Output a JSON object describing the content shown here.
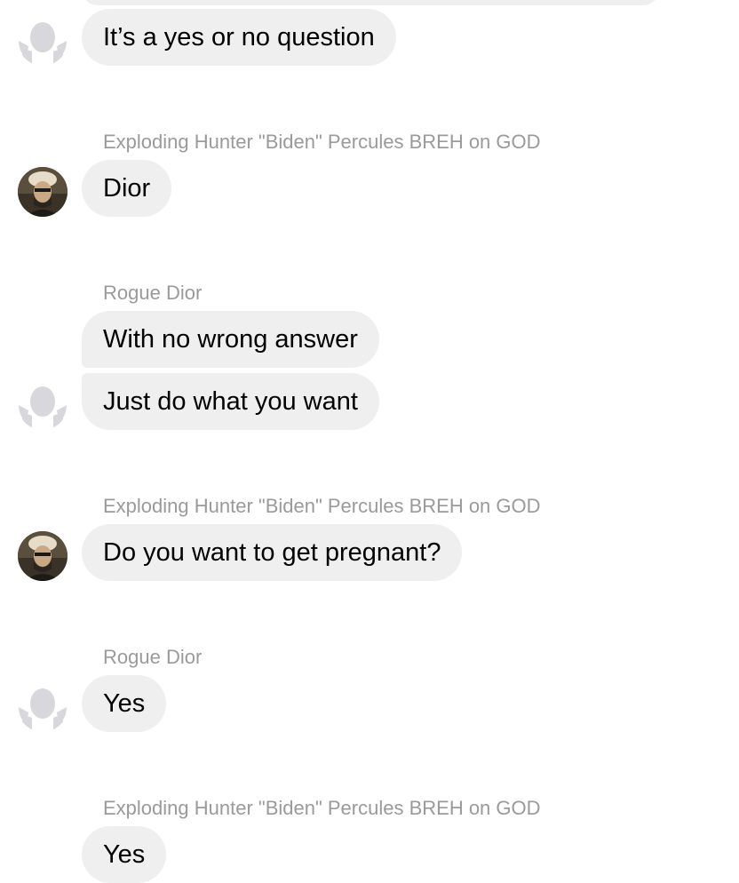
{
  "colors": {
    "bubble_bg": "#efefef",
    "sender_text": "#9a9a9a",
    "placeholder_avatar": "#d8d8dc"
  },
  "messages": [
    {
      "sender": "",
      "text": "It’s a yes or no question",
      "avatar": "placeholder-avatar-icon"
    },
    {
      "sender": "Exploding Hunter \"Biden\" Percules BREH on GOD",
      "text": "Dior",
      "avatar": "photo-avatar"
    },
    {
      "sender": "Rogue Dior",
      "texts": [
        "With no wrong answer",
        "Just do what you want"
      ],
      "avatar": "placeholder-avatar-icon"
    },
    {
      "sender": "Exploding Hunter \"Biden\" Percules BREH on GOD",
      "text": "Do you want to get pregnant?",
      "avatar": "photo-avatar"
    },
    {
      "sender": "Rogue Dior",
      "text": "Yes",
      "avatar": "placeholder-avatar-icon"
    },
    {
      "sender": "Exploding Hunter \"Biden\" Percules BREH on GOD",
      "text": "Yes",
      "avatar": "photo-avatar"
    }
  ]
}
